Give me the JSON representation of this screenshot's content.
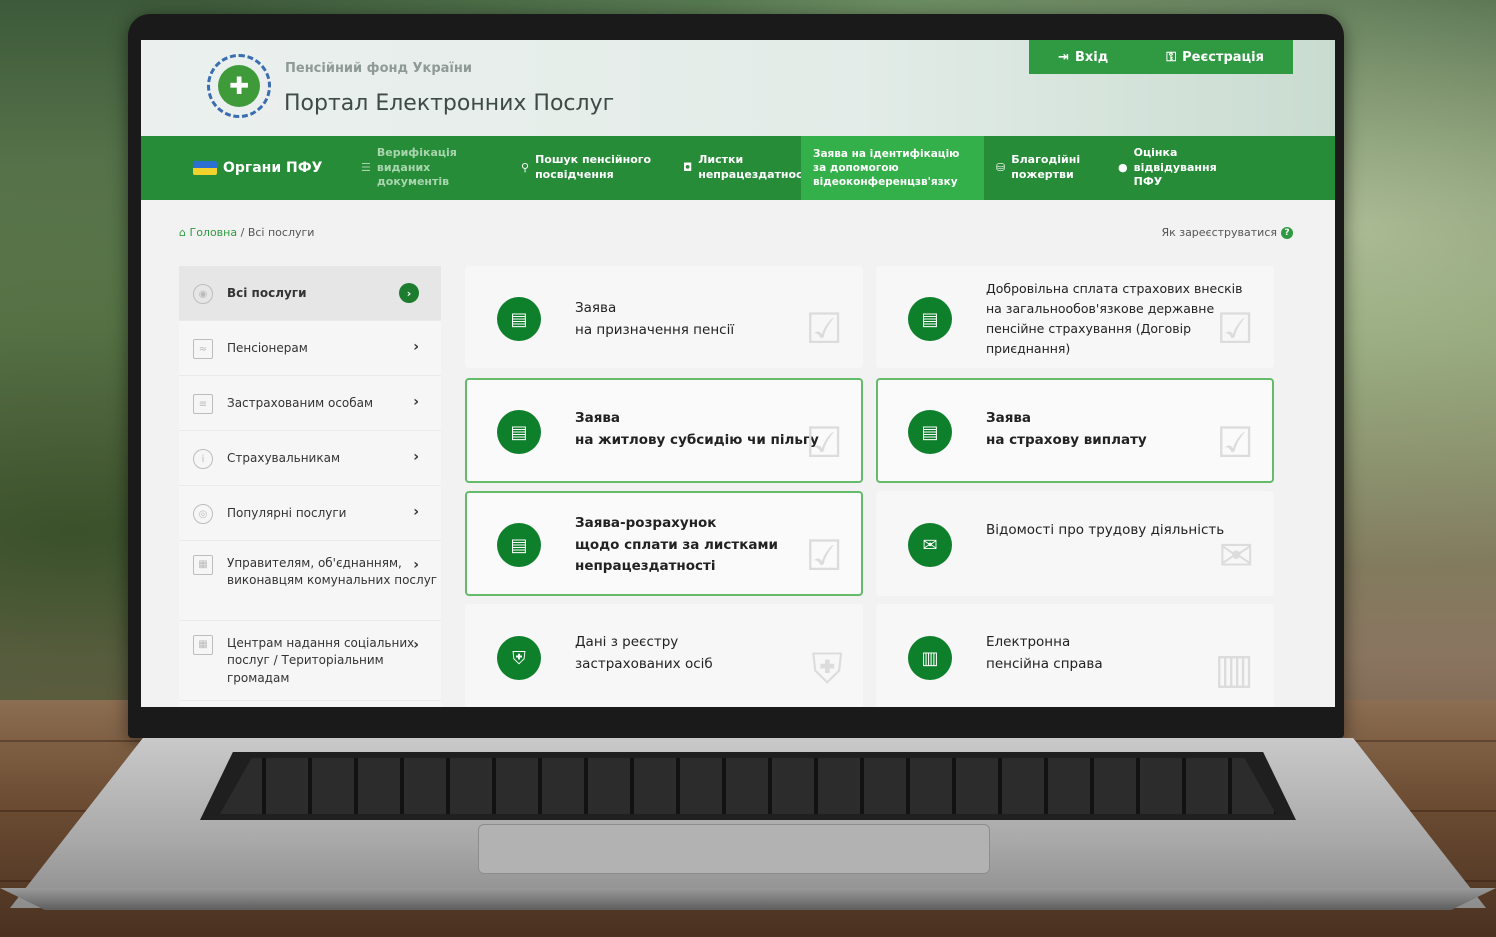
{
  "header": {
    "org_name": "Пенсійний фонд України",
    "portal_title": "Портал Електронних Послуг",
    "login_label": "Вхід",
    "register_label": "Реєстрація"
  },
  "nav": {
    "items": [
      {
        "label": "Органи ПФУ"
      },
      {
        "label": "Верифікація виданих документів"
      },
      {
        "label": "Пошук пенсійного посвідчення"
      },
      {
        "label": "Листки непрацездатності"
      },
      {
        "label": "Заява на ідентифікацію за допомогою відеоконференцзв'язку"
      },
      {
        "label": "Благодійні пожертви"
      },
      {
        "label": "Оцінка відвідування ПФУ"
      }
    ]
  },
  "breadcrumb": {
    "home": "Головна",
    "separator": "/",
    "current": "Всі послуги"
  },
  "how_to_register": "Як зареєструватися",
  "sidebar": {
    "items": [
      {
        "label": "Всі послуги"
      },
      {
        "label": "Пенсіонерам"
      },
      {
        "label": "Застрахованим особам"
      },
      {
        "label": "Страхувальникам"
      },
      {
        "label": "Популярні послуги"
      },
      {
        "label": "Управителям, об'єднанням, виконавцям комунальних послуг"
      },
      {
        "label": "Центрам надання соціальних послуг / Територіальним громадам"
      }
    ]
  },
  "cards": [
    {
      "line1": "Заява",
      "line2": "на призначення пенсії",
      "line3": ""
    },
    {
      "line1": "Добровільна сплата страхових внесків",
      "line2": "на загальнообов'язкове державне",
      "line3": "пенсійне страхування (Договір приєднання)"
    },
    {
      "line1": "Заява",
      "line2": "на житлову субсидію чи пільгу",
      "line3": ""
    },
    {
      "line1": "Заява",
      "line2": "на страхову виплату",
      "line3": ""
    },
    {
      "line1": "Заява-розрахунок",
      "line2": "щодо сплати за листками",
      "line3": "непрацездатності"
    },
    {
      "line1": "Відомості про трудову діяльність",
      "line2": "",
      "line3": ""
    },
    {
      "line1": "Дані з реєстру",
      "line2": "застрахованих осіб",
      "line3": ""
    },
    {
      "line1": "Електронна",
      "line2": "пенсійна справа",
      "line3": ""
    }
  ],
  "colors": {
    "brand_green": "#268c37",
    "active_nav": "#33b049",
    "card_icon": "#0e7f2b",
    "highlight_border": "#66bb6a"
  }
}
